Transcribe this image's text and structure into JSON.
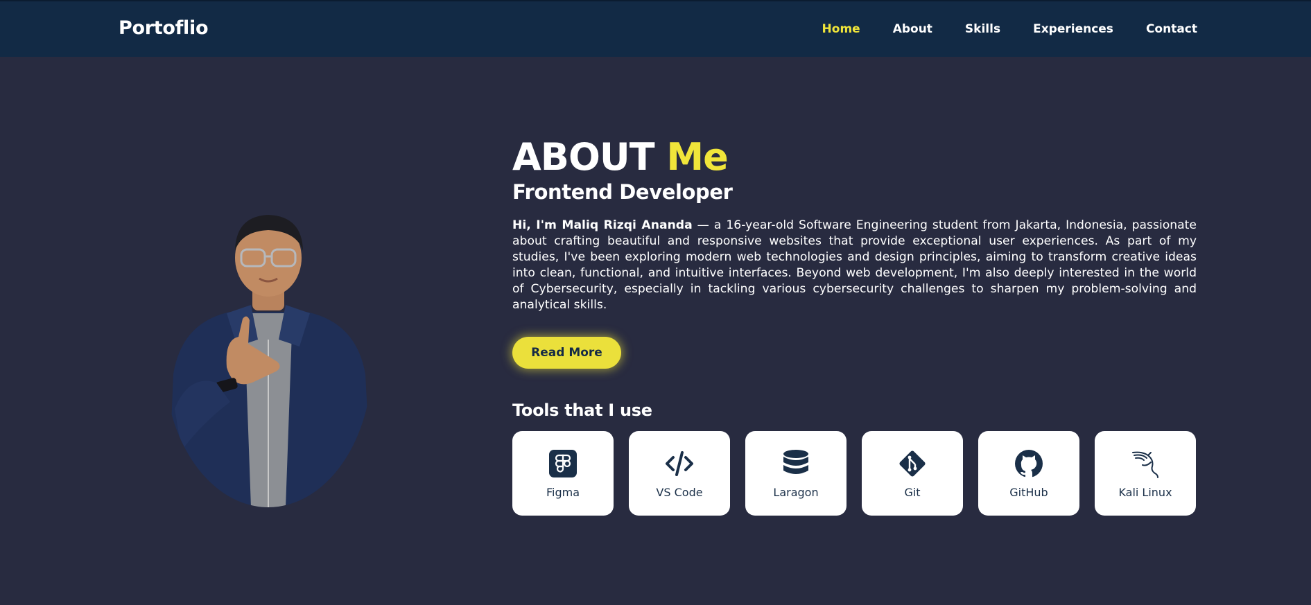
{
  "nav": {
    "brand": "Portoflio",
    "links": [
      {
        "label": "Home",
        "active": true
      },
      {
        "label": "About"
      },
      {
        "label": "Skills"
      },
      {
        "label": "Experiences"
      },
      {
        "label": "Contact"
      }
    ]
  },
  "about": {
    "title_main": "ABOUT",
    "title_accent": "Me",
    "subtitle": "Frontend Developer",
    "bio_intro": "Hi, I'm Maliq Rizqi Ananda",
    "bio_text": " — a 16-year-old Software Engineering student from Jakarta, Indonesia, passionate about crafting beautiful and responsive websites that provide exceptional user experiences. As part of my studies, I've been exploring modern web technologies and design principles, aiming to transform creative ideas into clean, functional, and intuitive interfaces. Beyond web development, I'm also deeply interested in the world of Cybersecurity, especially in tackling various cybersecurity challenges to sharpen my problem-solving and analytical skills.",
    "read_more_label": "Read More"
  },
  "tools": {
    "heading": "Tools that I use",
    "items": [
      {
        "label": "Figma",
        "icon": "figma-icon"
      },
      {
        "label": "VS Code",
        "icon": "code-icon"
      },
      {
        "label": "Laragon",
        "icon": "database-icon"
      },
      {
        "label": "Git",
        "icon": "git-icon"
      },
      {
        "label": "GitHub",
        "icon": "github-icon"
      },
      {
        "label": "Kali Linux",
        "icon": "kali-linux-icon"
      }
    ]
  },
  "colors": {
    "page_bg": "#282b40",
    "nav_bg": "#122a45",
    "accent": "#f0e53a",
    "icon": "#1a2f48"
  }
}
